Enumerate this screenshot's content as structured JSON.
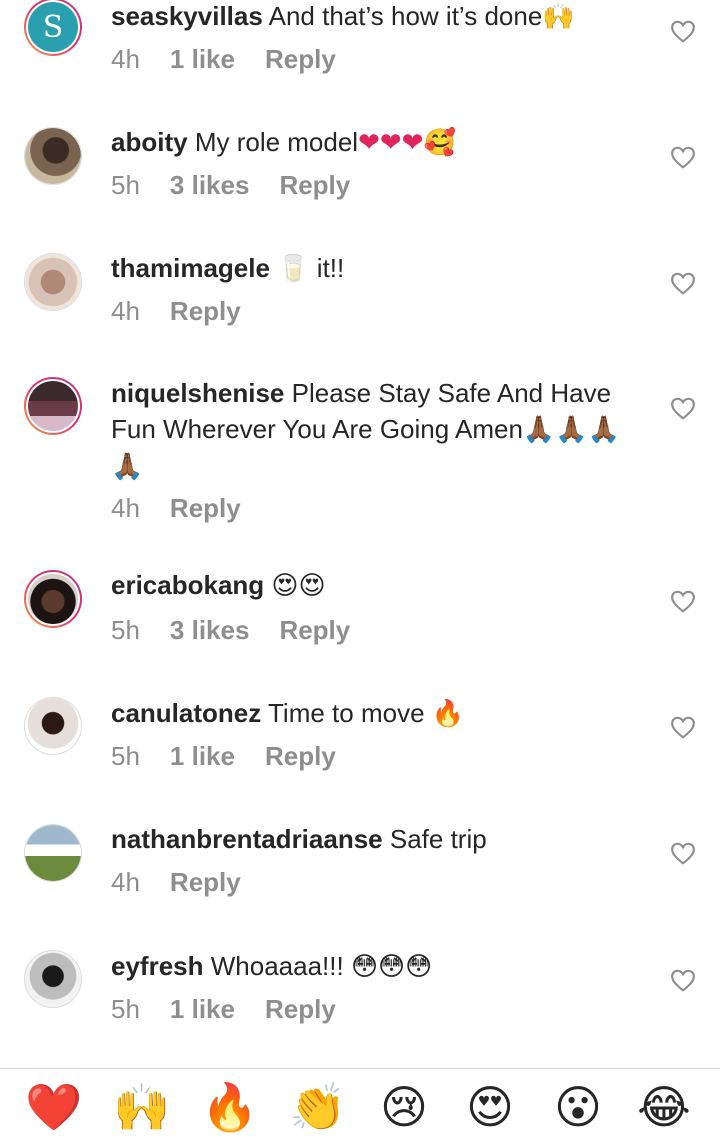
{
  "comments": [
    {
      "avatar": "S",
      "username": "seaskyvillas",
      "text": "And that’s how it’s done",
      "emoji": "🙌",
      "time": "4h",
      "likes": "1 like",
      "reply": "Reply"
    },
    {
      "avatar": "",
      "username": "aboity",
      "text": "My role model",
      "emoji": "❤❤❤🥰",
      "time": "5h",
      "likes": "3 likes",
      "reply": "Reply"
    },
    {
      "avatar": "",
      "username": "thamimagele",
      "text": " it!!",
      "emoji": "🥛",
      "time": "4h",
      "likes": "",
      "reply": "Reply"
    },
    {
      "avatar": "",
      "username": "niquelshenise",
      "text": "Please Stay Safe And Have Fun Wherever You Are Going Amen",
      "emoji": "🙏🏾🙏🏾🙏🏾🙏🏾",
      "time": "4h",
      "likes": "",
      "reply": "Reply"
    },
    {
      "avatar": "",
      "username": "ericabokang",
      "text": "",
      "emoji": "😍😍",
      "time": "5h",
      "likes": "3 likes",
      "reply": "Reply"
    },
    {
      "avatar": "",
      "username": "canulatonez",
      "text": "Time to move ",
      "emoji": "🔥",
      "time": "5h",
      "likes": "1 like",
      "reply": "Reply"
    },
    {
      "avatar": "",
      "username": "nathanbrentadriaanse",
      "text": "Safe trip",
      "emoji": "",
      "time": "4h",
      "likes": "",
      "reply": "Reply"
    },
    {
      "avatar": "",
      "username": "eyfresh",
      "text": "Whoaaaa!!! ",
      "emoji": "😳😳😳",
      "time": "5h",
      "likes": "1 like",
      "reply": "Reply"
    }
  ],
  "reactions": [
    "❤️",
    "🙌",
    "🔥",
    "👏",
    "😢",
    "😍",
    "😮",
    "😂"
  ],
  "colors": {
    "accent": "#262626",
    "muted": "#8e8e8e",
    "heart": "#ed4956"
  },
  "icons": {
    "like": "heart-outline-icon"
  }
}
